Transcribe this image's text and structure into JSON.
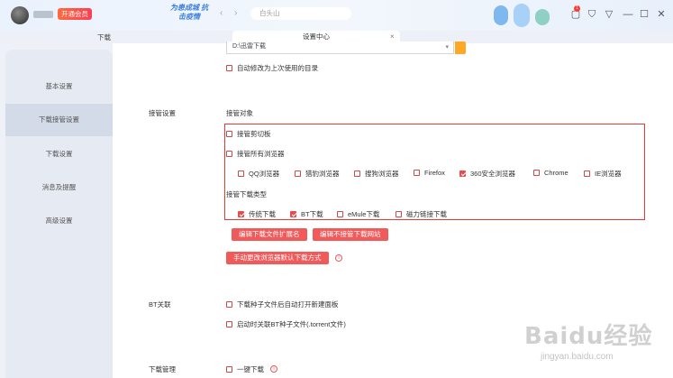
{
  "topbar": {
    "vip_label": "开通会员",
    "slogan": "为患成城 抗击疫情",
    "address": "白头山",
    "back_glyph": "‹",
    "forward_glyph": "›",
    "badge_count": "1"
  },
  "tabs": {
    "download": "下载",
    "settings": "设置中心",
    "close_glyph": "×"
  },
  "sidebar": {
    "items": [
      {
        "label": "基本设置"
      },
      {
        "label": "下载接管设置"
      },
      {
        "label": "下载设置"
      },
      {
        "label": "消息及提醒"
      },
      {
        "label": "高级设置"
      }
    ]
  },
  "directory": {
    "value": "D:\\迅雷下载",
    "remember_label": "自动修改为上次使用的目录"
  },
  "takeover": {
    "section_label": "接管设置",
    "target_label": "接管对象",
    "clipboard_label": "接管剪切板",
    "all_browsers_label": "接管所有浏览器",
    "browsers": [
      {
        "label": "QQ浏览器",
        "checked": false
      },
      {
        "label": "猎豹浏览器",
        "checked": false
      },
      {
        "label": "搜狗浏览器",
        "checked": false
      },
      {
        "label": "Firefox",
        "checked": false
      },
      {
        "label": "360安全浏览器",
        "checked": true
      },
      {
        "label": "Chrome",
        "checked": false
      },
      {
        "label": "IE浏览器",
        "checked": false
      }
    ],
    "types_label": "接管下载类型",
    "types": [
      {
        "label": "传统下载",
        "checked": true
      },
      {
        "label": "BT下载",
        "checked": true
      },
      {
        "label": "eMule下载",
        "checked": false
      },
      {
        "label": "磁力链接下载",
        "checked": false
      }
    ],
    "edit_ext_button": "编辑下载文件扩展名",
    "edit_sites_button": "编辑不接管下载网站",
    "manual_change_button": "手动更改浏览器默认下载方式"
  },
  "bt": {
    "section_label": "BT关联",
    "open_panel_label": "下载种子文件后自动打开新建面板",
    "associate_label": "启动时关联BT种子文件(.torrent文件)"
  },
  "manage": {
    "section_label": "下载管理",
    "one_click_label": "一键下载"
  },
  "watermark": {
    "main": "Baidu经验",
    "sub": "jingyan.baidu.com"
  },
  "colors": {
    "accent_red": "#e53935",
    "button_red": "#f05a5a",
    "sidebar_bg": "#e6ebf3"
  }
}
